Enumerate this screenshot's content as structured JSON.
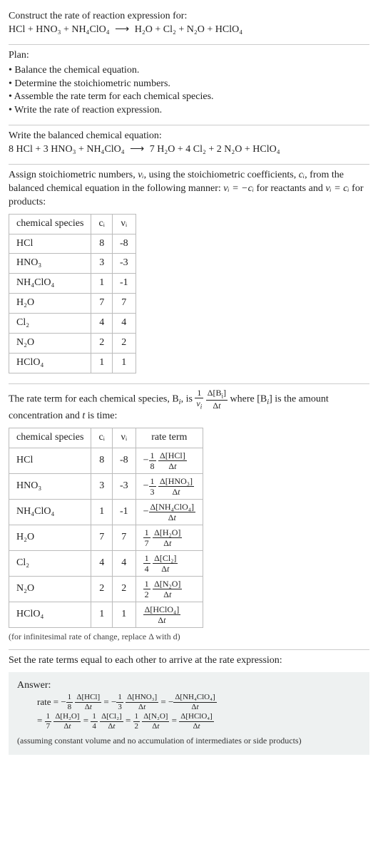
{
  "prompt": {
    "title": "Construct the rate of reaction expression for:",
    "equation_left": "HCl + HNO₃ + NH₄ClO₄",
    "equation_right": "H₂O + Cl₂ + N₂O + HClO₄"
  },
  "plan": {
    "heading": "Plan:",
    "items": [
      "Balance the chemical equation.",
      "Determine the stoichiometric numbers.",
      "Assemble the rate term for each chemical species.",
      "Write the rate of reaction expression."
    ]
  },
  "balanced": {
    "heading": "Write the balanced chemical equation:",
    "equation_left": "8 HCl + 3 HNO₃ + NH₄ClO₄",
    "equation_right": "7 H₂O + 4 Cl₂ + 2 N₂O + HClO₄"
  },
  "stoich": {
    "intro_a": "Assign stoichiometric numbers, ",
    "intro_b": ", using the stoichiometric coefficients, ",
    "intro_c": ", from the balanced chemical equation in the following manner: ",
    "intro_d": " for reactants and ",
    "intro_e": " for products:",
    "nu": "νᵢ",
    "ci": "cᵢ",
    "rel_react": "νᵢ = −cᵢ",
    "rel_prod": "νᵢ = cᵢ",
    "headers": [
      "chemical species",
      "cᵢ",
      "νᵢ"
    ],
    "rows": [
      {
        "sp": "HCl",
        "c": "8",
        "v": "-8"
      },
      {
        "sp": "HNO₃",
        "c": "3",
        "v": "-3"
      },
      {
        "sp": "NH₄ClO₄",
        "c": "1",
        "v": "-1"
      },
      {
        "sp": "H₂O",
        "c": "7",
        "v": "7"
      },
      {
        "sp": "Cl₂",
        "c": "4",
        "v": "4"
      },
      {
        "sp": "N₂O",
        "c": "2",
        "v": "2"
      },
      {
        "sp": "HClO₄",
        "c": "1",
        "v": "1"
      }
    ]
  },
  "rateterm": {
    "intro_a": "The rate term for each chemical species, B",
    "intro_b": ", is ",
    "intro_c": " where [B",
    "intro_d": "] is the amount concentration and ",
    "intro_e": " is time:",
    "t": "t",
    "headers": [
      "chemical species",
      "cᵢ",
      "νᵢ",
      "rate term"
    ],
    "rows": [
      {
        "sp": "HCl",
        "c": "8",
        "v": "-8",
        "coef": "−",
        "f": "1",
        "d": "8",
        "br": "Δ[HCl]",
        "bt": "Δt"
      },
      {
        "sp": "HNO₃",
        "c": "3",
        "v": "-3",
        "coef": "−",
        "f": "1",
        "d": "3",
        "br": "Δ[HNO₃]",
        "bt": "Δt"
      },
      {
        "sp": "NH₄ClO₄",
        "c": "1",
        "v": "-1",
        "coef": "−",
        "f": "",
        "d": "",
        "br": "Δ[NH₄ClO₄]",
        "bt": "Δt"
      },
      {
        "sp": "H₂O",
        "c": "7",
        "v": "7",
        "coef": "",
        "f": "1",
        "d": "7",
        "br": "Δ[H₂O]",
        "bt": "Δt"
      },
      {
        "sp": "Cl₂",
        "c": "4",
        "v": "4",
        "coef": "",
        "f": "1",
        "d": "4",
        "br": "Δ[Cl₂]",
        "bt": "Δt"
      },
      {
        "sp": "N₂O",
        "c": "2",
        "v": "2",
        "coef": "",
        "f": "1",
        "d": "2",
        "br": "Δ[N₂O]",
        "bt": "Δt"
      },
      {
        "sp": "HClO₄",
        "c": "1",
        "v": "1",
        "coef": "",
        "f": "",
        "d": "",
        "br": "Δ[HClO₄]",
        "bt": "Δt"
      }
    ],
    "note": "(for infinitesimal rate of change, replace Δ with d)"
  },
  "final": {
    "heading": "Set the rate terms equal to each other to arrive at the rate expression:",
    "answer_label": "Answer:",
    "rate_label": "rate",
    "note": "(assuming constant volume and no accumulation of intermediates or side products)"
  }
}
